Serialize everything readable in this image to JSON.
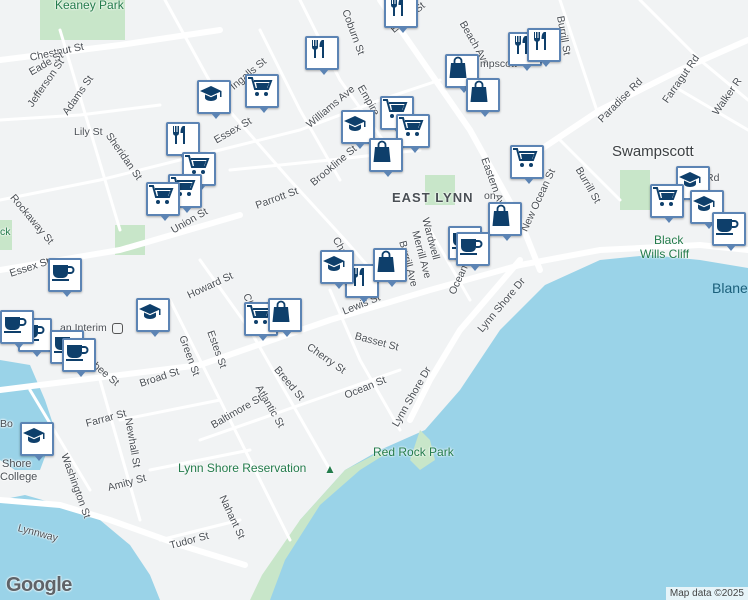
{
  "map": {
    "colors": {
      "water": "#9ad3e8",
      "land": "#f1f3f4",
      "park": "#c8e6c9",
      "road": "#ffffff",
      "pin_border": "#5c84b4",
      "icon": "#0e3f6b"
    },
    "areas": [
      "EAST LYNN"
    ],
    "towns": [
      "Swampscott"
    ],
    "parks": [
      "Keaney Park",
      "Lynn Shore Reservation",
      "Red Rock Park",
      "Black",
      "Wills Cliff"
    ],
    "water_labels": [
      "Blane"
    ],
    "transit": {
      "label": "an Interim"
    },
    "streets": {
      "chestnut": "Chestnut St",
      "eade": "Eade St",
      "jefferson": "Jefferson St",
      "adams": "Adams St",
      "lily": "Lily St",
      "sheridan": "Sheridan St",
      "rockaway": "Rockaway St",
      "ingalls": "Ingalls St",
      "essex_w": "Essex St",
      "union": "Union St",
      "parrott": "Parrott St",
      "williams": "Williams Ave",
      "brookline": "Brookline St",
      "empire": "Empire",
      "coburn": "Coburn St",
      "essex_n": "Essex St",
      "beach": "Beach Ave",
      "burrill_n": "Burrill St",
      "paradise": "Paradise Rd",
      "farragut": "Farragut Rd",
      "walker": "Walker R",
      "burrill_s": "Burrill St",
      "new_ocean": "New Ocean St",
      "eastern": "Eastern Av",
      "wardwell": "Wardwell",
      "merrill": "Merrill Ave",
      "burrill_ave": "Burrill Ave",
      "essex_sw": "Essex St",
      "howard": "Howard St",
      "chatham": "Chatham",
      "ch": "Ch",
      "lewis": "Lewis St",
      "basset": "Basset St",
      "ocean_n": "Ocean St",
      "estes": "Estes St",
      "green": "Green St",
      "cherry": "Cherry St",
      "broad": "Broad St",
      "breed": "Breed St",
      "atlantic": "Atlantic St",
      "ocean_s": "Ocean St",
      "baltimore": "Baltimore St",
      "lynn_shore_a": "Lynn Shore Dr",
      "lynn_shore_b": "Lynn Shore Dr",
      "farrar": "Farrar St",
      "newhall": "Newhall St",
      "washington": "Washington St",
      "amity": "Amity St",
      "nahant": "Nahant St",
      "tudor": "Tudor St",
      "lynnway": "Lynnway",
      "carlisbee": "rlisbee St",
      "gr": "Gr",
      "bo": "Bo",
      "shore": "Shore",
      "college": "College",
      "ck": "ck",
      "ha": "Ha",
      "mpscott": "mpscott",
      "rd": "Rd",
      "on": "on"
    },
    "pins": [
      {
        "name": "restaurant-pin",
        "icon": "fork-knife-icon"
      },
      {
        "name": "restaurant-pin",
        "icon": "fork-knife-icon"
      },
      {
        "name": "restaurant-pin",
        "icon": "fork-knife-icon"
      },
      {
        "name": "restaurant-pin",
        "icon": "fork-knife-icon"
      },
      {
        "name": "school-pin",
        "icon": "graduation-cap-icon"
      },
      {
        "name": "grocery-pin",
        "icon": "cart-icon"
      },
      {
        "name": "shopping-pin",
        "icon": "bag-icon"
      },
      {
        "name": "cafe-pin",
        "icon": "coffee-cup-icon"
      }
    ]
  },
  "brand": {
    "logo": "Google",
    "attribution": "Map data ©2025"
  }
}
